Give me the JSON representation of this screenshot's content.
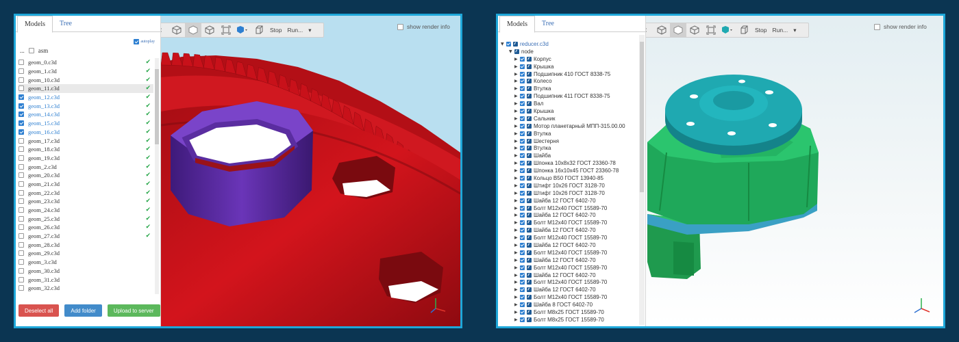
{
  "left_window": {
    "tabs": [
      "Models",
      "Tree"
    ],
    "autoplay_label": "autoplay",
    "folder_name": "asm",
    "folder_dots": "...",
    "items": [
      {
        "label": "geom_0.c3d",
        "checked": false,
        "loaded": true,
        "highlighted": false
      },
      {
        "label": "geom_1.c3d",
        "checked": false,
        "loaded": true,
        "highlighted": false
      },
      {
        "label": "geom_10.c3d",
        "checked": false,
        "loaded": true,
        "highlighted": false
      },
      {
        "label": "geom_11.c3d",
        "checked": false,
        "loaded": true,
        "highlighted": true
      },
      {
        "label": "geom_12.c3d",
        "checked": true,
        "loaded": true,
        "highlighted": false
      },
      {
        "label": "geom_13.c3d",
        "checked": true,
        "loaded": true,
        "highlighted": false
      },
      {
        "label": "geom_14.c3d",
        "checked": true,
        "loaded": true,
        "highlighted": false
      },
      {
        "label": "geom_15.c3d",
        "checked": true,
        "loaded": true,
        "highlighted": false
      },
      {
        "label": "geom_16.c3d",
        "checked": true,
        "loaded": true,
        "highlighted": false
      },
      {
        "label": "geom_17.c3d",
        "checked": false,
        "loaded": true,
        "highlighted": false
      },
      {
        "label": "geom_18.c3d",
        "checked": false,
        "loaded": true,
        "highlighted": false
      },
      {
        "label": "geom_19.c3d",
        "checked": false,
        "loaded": true,
        "highlighted": false
      },
      {
        "label": "geom_2.c3d",
        "checked": false,
        "loaded": true,
        "highlighted": false
      },
      {
        "label": "geom_20.c3d",
        "checked": false,
        "loaded": true,
        "highlighted": false
      },
      {
        "label": "geom_21.c3d",
        "checked": false,
        "loaded": true,
        "highlighted": false
      },
      {
        "label": "geom_22.c3d",
        "checked": false,
        "loaded": true,
        "highlighted": false
      },
      {
        "label": "geom_23.c3d",
        "checked": false,
        "loaded": true,
        "highlighted": false
      },
      {
        "label": "geom_24.c3d",
        "checked": false,
        "loaded": true,
        "highlighted": false
      },
      {
        "label": "geom_25.c3d",
        "checked": false,
        "loaded": true,
        "highlighted": false
      },
      {
        "label": "geom_26.c3d",
        "checked": false,
        "loaded": true,
        "highlighted": false
      },
      {
        "label": "geom_27.c3d",
        "checked": false,
        "loaded": true,
        "highlighted": false
      },
      {
        "label": "geom_28.c3d",
        "checked": false,
        "loaded": false,
        "highlighted": false
      },
      {
        "label": "geom_29.c3d",
        "checked": false,
        "loaded": false,
        "highlighted": false
      },
      {
        "label": "geom_3.c3d",
        "checked": false,
        "loaded": false,
        "highlighted": false
      },
      {
        "label": "geom_30.c3d",
        "checked": false,
        "loaded": false,
        "highlighted": false
      },
      {
        "label": "geom_31.c3d",
        "checked": false,
        "loaded": false,
        "highlighted": false
      },
      {
        "label": "geom_32.c3d",
        "checked": false,
        "loaded": false,
        "highlighted": false
      }
    ],
    "buttons": {
      "deselect": "Deselect all",
      "add_folder": "Add folder",
      "upload": "Upload to server"
    }
  },
  "toolbar": {
    "stop": "Stop",
    "run": "Run...",
    "render_info": "show render info"
  },
  "right_window": {
    "tabs": [
      "Models",
      "Tree"
    ],
    "root": "reducer.c3d",
    "node": "node",
    "nodes": [
      "Корпус",
      "Крышка",
      "Подшипник 410 ГОСТ 8338-75",
      "Колесо",
      "Втулка",
      "Подшипник 411 ГОСТ 8338-75",
      "Вал",
      "Крышка",
      "Сальник",
      "Мотор планетарный МПП-315.00.00",
      "Втулка",
      "Шестерня",
      "Втулка",
      "Шайба",
      "Шпонка 10х8х32 ГОСТ 23360-78",
      "Шпонка 16х10х45 ГОСТ 23360-78",
      "Кольцо В50 ГОСТ 13940-85",
      "Штифт 10х26 ГОСТ 3128-70",
      "Штифт 10х26 ГОСТ 3128-70",
      "Шайба 12 ГОСТ 6402-70",
      "Болт М12х40 ГОСТ 15589-70",
      "Шайба 12 ГОСТ 6402-70",
      "Болт М12х40 ГОСТ 15589-70",
      "Шайба 12 ГОСТ 6402-70",
      "Болт М12х40 ГОСТ 15589-70",
      "Шайба 12 ГОСТ 6402-70",
      "Болт М12х40 ГОСТ 15589-70",
      "Шайба 12 ГОСТ 6402-70",
      "Болт М12х40 ГОСТ 15589-70",
      "Шайба 12 ГОСТ 6402-70",
      "Болт М12х40 ГОСТ 15589-70",
      "Шайба 12 ГОСТ 6402-70",
      "Болт М12х40 ГОСТ 15589-70",
      "Шайба 8 ГОСТ 6402-70",
      "Болт М8х25 ГОСТ 15589-70",
      "Болт М8х25 ГОСТ 15589-70"
    ]
  },
  "colors": {
    "frame": "#1ea7d9",
    "gear": "#c8101a",
    "bushing": "#5a2da0",
    "housing": "#1fa85a",
    "cover": "#1fa0a8"
  }
}
